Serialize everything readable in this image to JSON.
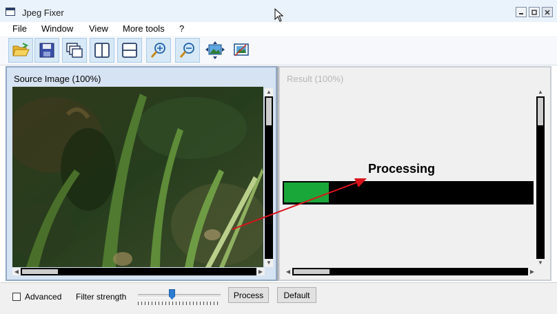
{
  "window": {
    "title": "Jpeg Fixer"
  },
  "menu": {
    "items": [
      "File",
      "Window",
      "View",
      "More tools",
      "?"
    ]
  },
  "toolbar": {
    "icons": [
      "open-folder-icon",
      "save-icon",
      "cascade-windows-icon",
      "split-vertical-icon",
      "split-horizontal-icon",
      "zoom-in-icon",
      "zoom-out-icon",
      "fit-to-window-icon",
      "actual-size-icon"
    ]
  },
  "panels": {
    "source_title": "Source Image (100%)",
    "result_title": "Result (100%)"
  },
  "progress": {
    "value": 0.18,
    "label": "Processing",
    "color": "#1aa73a"
  },
  "controls": {
    "advanced_label": "Advanced",
    "advanced_checked": false,
    "filter_strength_label": "Filter strength",
    "filter_strength_value": 0.4,
    "process_label": "Process",
    "default_label": "Default"
  },
  "colors": {
    "accent": "#d7e8f6",
    "annotation_arrow": "#d9141b"
  }
}
